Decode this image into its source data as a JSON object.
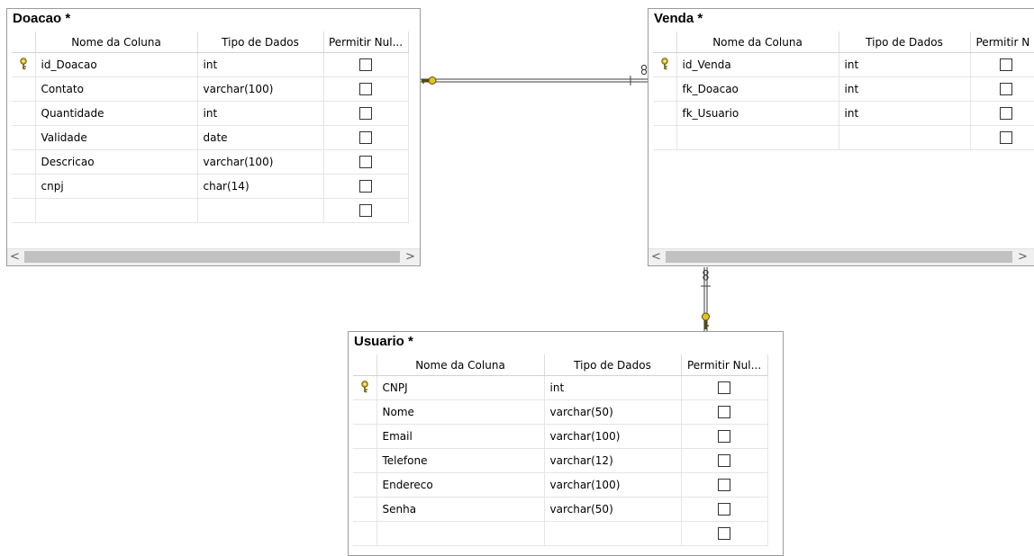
{
  "columns_header": {
    "name": "Nome da Coluna",
    "type": "Tipo de Dados",
    "null_doacao": "Permitir Nul...",
    "null_venda": "Permitir N",
    "null_usuario": "Permitir Nul..."
  },
  "doacao": {
    "title": "Doacao *",
    "rows": [
      {
        "name": "id_Doacao",
        "type": "int",
        "key": true
      },
      {
        "name": "Contato",
        "type": "varchar(100)",
        "key": false
      },
      {
        "name": "Quantidade",
        "type": "int",
        "key": false
      },
      {
        "name": "Validade",
        "type": "date",
        "key": false
      },
      {
        "name": "Descricao",
        "type": "varchar(100)",
        "key": false
      },
      {
        "name": "cnpj",
        "type": "char(14)",
        "key": false
      },
      {
        "name": "",
        "type": "",
        "key": false
      }
    ]
  },
  "venda": {
    "title": "Venda *",
    "rows": [
      {
        "name": "id_Venda",
        "type": "int",
        "key": true
      },
      {
        "name": "fk_Doacao",
        "type": "int",
        "key": false
      },
      {
        "name": "fk_Usuario",
        "type": "int",
        "key": false
      },
      {
        "name": "",
        "type": "",
        "key": false
      }
    ]
  },
  "usuario": {
    "title": "Usuario *",
    "rows": [
      {
        "name": "CNPJ",
        "type": "int",
        "key": true
      },
      {
        "name": "Nome",
        "type": "varchar(50)",
        "key": false
      },
      {
        "name": "Email",
        "type": "varchar(100)",
        "key": false
      },
      {
        "name": "Telefone",
        "type": "varchar(12)",
        "key": false
      },
      {
        "name": "Endereco",
        "type": "varchar(100)",
        "key": false
      },
      {
        "name": "Senha",
        "type": "varchar(50)",
        "key": false
      },
      {
        "name": "",
        "type": "",
        "key": false
      }
    ]
  },
  "scrollbar": {
    "left_arrow": "<",
    "right_arrow": ">"
  },
  "icons": {
    "primary_key": "key-icon",
    "relationship_key_end": "key-icon",
    "relationship_many_end": "infinity-icon"
  },
  "colors": {
    "key": "#e2c22c",
    "line": "#3f3f3f",
    "border": "#9b9b9b"
  }
}
